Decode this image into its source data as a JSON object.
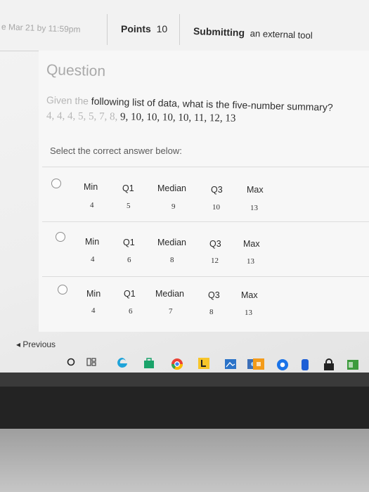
{
  "header": {
    "due": "e Mar 21 by 11:59pm",
    "points_label": "Points",
    "points_value": "10",
    "submitting_label": "Submitting",
    "submitting_value": "an external tool"
  },
  "question": {
    "title": "Question",
    "prompt_dim": "Given the",
    "prompt": "following list of data, what is the five-number summary?",
    "data_dim": "4, 4, 4, 5, 5, 7, 8,",
    "data": "9, 10, 10, 10, 10, 11, 12, 13",
    "instruction": "Select the correct answer below:"
  },
  "columns": [
    "Min",
    "Q1",
    "Median",
    "Q3",
    "Max"
  ],
  "options": [
    {
      "values": [
        "4",
        "5",
        "9",
        "10",
        "13"
      ]
    },
    {
      "values": [
        "4",
        "6",
        "8",
        "12",
        "13"
      ]
    },
    {
      "values": [
        "4",
        "6",
        "7",
        "8",
        "13"
      ]
    }
  ],
  "nav": {
    "previous": "◂ Previous"
  },
  "taskbar": {
    "icons": [
      "search-circle-icon",
      "task-view-icon",
      "edge-browser-icon",
      "store-icon",
      "chrome-icon",
      "l-app-icon",
      "photos-icon",
      "image-icon",
      "orange-app-icon",
      "chrome-blue-icon",
      "blue-app-icon",
      "lock-icon",
      "green-app-icon"
    ],
    "colors": {
      "edge": "#1fa3d9",
      "store": "#1aa36a",
      "chrome": "#e94235",
      "l_app": "#f7c52a",
      "photos": "#2b73c8",
      "orange": "#f39b1a",
      "green": "#3c9b3c"
    }
  }
}
